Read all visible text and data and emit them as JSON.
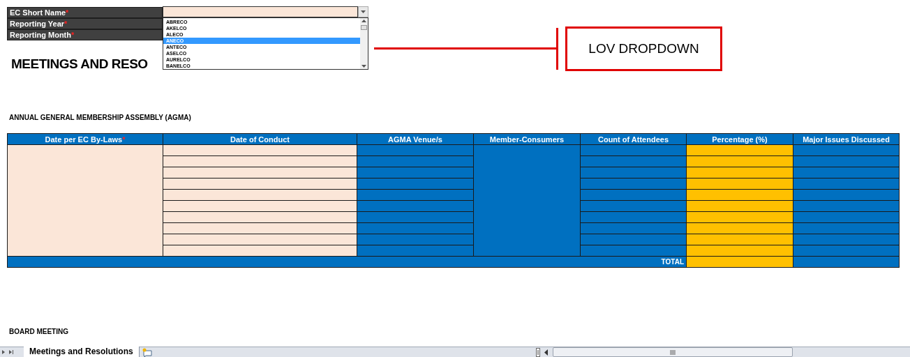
{
  "form_fields": [
    {
      "label": "EC Short Name",
      "required_mark": "*"
    },
    {
      "label": "Reporting Year",
      "required_mark": "*"
    },
    {
      "label": "Reporting Month",
      "required_mark": "*"
    }
  ],
  "dropdown": {
    "items": [
      {
        "label": "ABRECO",
        "selected": false
      },
      {
        "label": "AKELCO",
        "selected": false
      },
      {
        "label": "ALECO",
        "selected": false
      },
      {
        "label": "ANECO",
        "selected": true
      },
      {
        "label": "ANTECO",
        "selected": false
      },
      {
        "label": "ASELCO",
        "selected": false
      },
      {
        "label": "AURELCO",
        "selected": false
      },
      {
        "label": "BANELCO",
        "selected": false
      }
    ]
  },
  "page_title": "MEETINGS AND RESO",
  "annotation": {
    "label": "LOV DROPDOWN"
  },
  "agma": {
    "section_title": "ANNUAL GENERAL MEMBERSHIP ASSEMBLY (AGMA)",
    "columns": [
      {
        "label": "Date per EC By-Laws",
        "required_mark": "*",
        "kind": "input",
        "merged": true
      },
      {
        "label": "Date of Conduct",
        "kind": "input",
        "merged": false
      },
      {
        "label": "AGMA Venue/s",
        "kind": "field",
        "merged": false
      },
      {
        "label": "Member-Consumers",
        "kind": "field",
        "merged": true
      },
      {
        "label": "Count of Attendees",
        "kind": "field",
        "merged": false
      },
      {
        "label": "Percentage (%)",
        "kind": "computed",
        "merged": false
      },
      {
        "label": "Major Issues Discussed",
        "kind": "field",
        "merged": false
      }
    ],
    "total_label": "TOTAL"
  },
  "board_section_title": "BOARD MEETING",
  "sheet_tabs": [
    {
      "label": "Meetings and Resolutions",
      "selected": true
    }
  ]
}
